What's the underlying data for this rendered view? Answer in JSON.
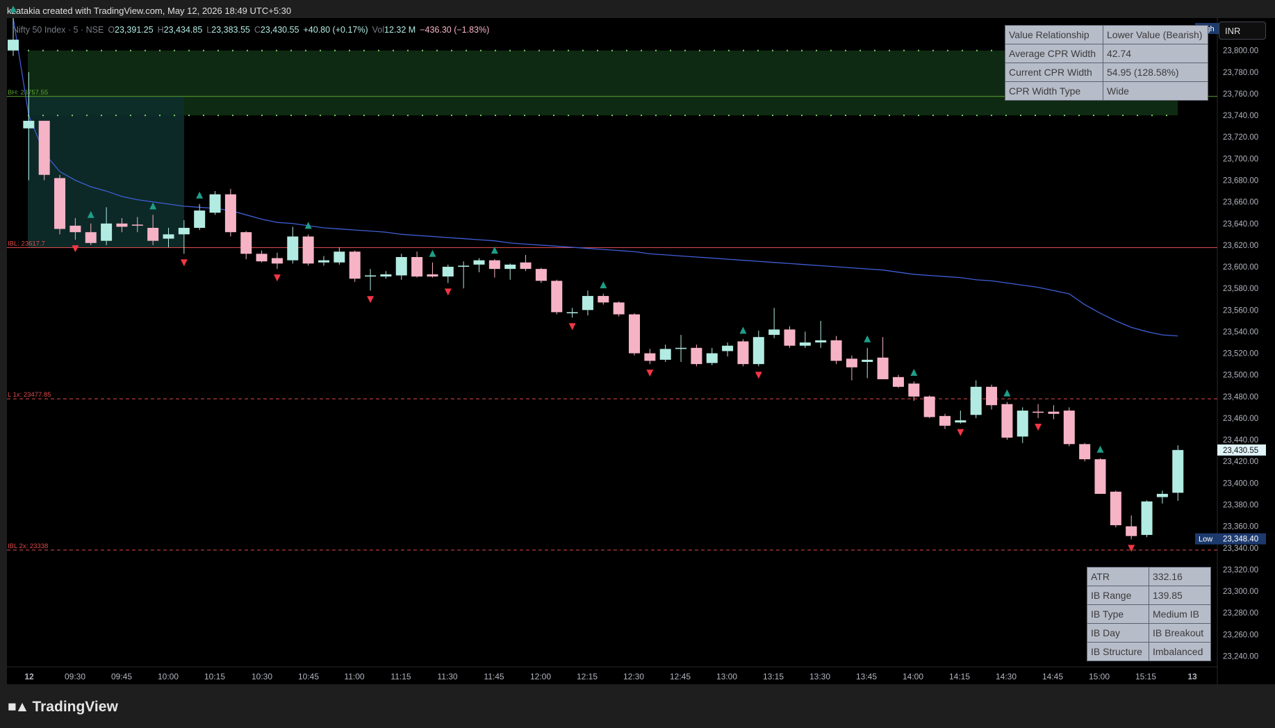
{
  "header": {
    "credit": "kzatakia created with TradingView.com, May 12, 2026 18:49 UTC+5:30"
  },
  "legend": {
    "symbol": "Nifty 50 Index · 5 · NSE",
    "open_label": "O",
    "open": "23,391.25",
    "high_label": "H",
    "high": "23,434.85",
    "low_label": "L",
    "low": "23,383.55",
    "close_label": "C",
    "close": "23,430.55",
    "change": "+40.80 (+0.17%)",
    "vol_label": "Vol",
    "vol": "12.32 M",
    "day_change": "−436.30 (−1.83%)"
  },
  "currency_button": "INR",
  "cpr_table": [
    [
      "Value Relationship",
      "Lower Value (Bearish)"
    ],
    [
      "Average CPR Width",
      "42.74"
    ],
    [
      "Current CPR Width",
      "54.95 (128.58%)"
    ],
    [
      "CPR Width Type",
      "Wide"
    ]
  ],
  "ib_table": [
    [
      "ATR",
      "332.16"
    ],
    [
      "IB Range",
      "139.85"
    ],
    [
      "IB Type",
      "Medium IB"
    ],
    [
      "IB Day",
      "IB Breakout"
    ],
    [
      "IB Structure",
      "Imbalanced"
    ]
  ],
  "footer": {
    "brand": "TradingView"
  },
  "colors": {
    "up": "#b2ebe2",
    "down": "#f7b3c6",
    "ema": "#3f5fd6",
    "ib_line": "#e04a4a",
    "bh_line": "#5aa832",
    "cpr_band": "#0f2a12",
    "ib_box": "#0d2e2b",
    "buy_signal": "#1f9e89",
    "sell_signal": "#f23645",
    "background": "#000000"
  },
  "chart_data": {
    "type": "candlestick",
    "ylim": [
      23230,
      23830
    ],
    "y_ticks": [
      23240,
      23260,
      23280,
      23300,
      23320,
      23340,
      23360,
      23380,
      23400,
      23420,
      23440,
      23460,
      23480,
      23500,
      23520,
      23540,
      23560,
      23580,
      23600,
      23620,
      23640,
      23660,
      23680,
      23700,
      23720,
      23740,
      23760,
      23780,
      23800
    ],
    "x_ticks": [
      "12",
      "09:30",
      "09:45",
      "10:00",
      "10:15",
      "10:30",
      "10:45",
      "11:00",
      "11:15",
      "11:30",
      "11:45",
      "12:00",
      "12:15",
      "12:30",
      "12:45",
      "13:00",
      "13:15",
      "13:30",
      "13:45",
      "14:00",
      "14:15",
      "14:30",
      "14:45",
      "15:00",
      "15:15",
      "13"
    ],
    "price_labels": [
      {
        "name": "High",
        "value": 23820.35,
        "text": "23,820.35"
      },
      {
        "name": "",
        "value": 23430.55,
        "text": "23,430.55"
      },
      {
        "name": "Low",
        "value": 23348.4,
        "text": "23,348.40"
      }
    ],
    "levels": [
      {
        "label": "BH: 23757.55",
        "value": 23757.55,
        "style": "solid"
      },
      {
        "label": "IBL: 23617.7",
        "value": 23617.7,
        "style": "solid"
      },
      {
        "label": "L 1x: 23477.85",
        "value": 23477.85,
        "style": "dashed"
      },
      {
        "label": "IBL 2x: 23338",
        "value": 23338,
        "style": "dashed"
      }
    ],
    "cpr_band": [
      23740,
      23800
    ],
    "ib_box": [
      23617.7,
      23757.55
    ],
    "candles": [
      {
        "o": 23800,
        "h": 23830,
        "l": 23795,
        "c": 23810
      },
      {
        "o": 23728,
        "h": 23780,
        "l": 23680,
        "c": 23735
      },
      {
        "o": 23735,
        "h": 23735,
        "l": 23680,
        "c": 23685
      },
      {
        "o": 23682,
        "h": 23685,
        "l": 23630,
        "c": 23635
      },
      {
        "o": 23638,
        "h": 23645,
        "l": 23625,
        "c": 23632
      },
      {
        "o": 23632,
        "h": 23640,
        "l": 23620,
        "c": 23622
      },
      {
        "o": 23624,
        "h": 23655,
        "l": 23620,
        "c": 23640
      },
      {
        "o": 23640,
        "h": 23645,
        "l": 23632,
        "c": 23637
      },
      {
        "o": 23639,
        "h": 23646,
        "l": 23632,
        "c": 23638
      },
      {
        "o": 23636,
        "h": 23648,
        "l": 23620,
        "c": 23624
      },
      {
        "o": 23626,
        "h": 23636,
        "l": 23618,
        "c": 23630
      },
      {
        "o": 23630,
        "h": 23643,
        "l": 23612,
        "c": 23636
      },
      {
        "o": 23636,
        "h": 23658,
        "l": 23634,
        "c": 23652
      },
      {
        "o": 23650,
        "h": 23670,
        "l": 23648,
        "c": 23667
      },
      {
        "o": 23667,
        "h": 23672,
        "l": 23628,
        "c": 23632
      },
      {
        "o": 23632,
        "h": 23633,
        "l": 23607,
        "c": 23612
      },
      {
        "o": 23612,
        "h": 23615,
        "l": 23604,
        "c": 23605
      },
      {
        "o": 23608,
        "h": 23613,
        "l": 23598,
        "c": 23603
      },
      {
        "o": 23606,
        "h": 23637,
        "l": 23603,
        "c": 23628
      },
      {
        "o": 23628,
        "h": 23630,
        "l": 23601,
        "c": 23603
      },
      {
        "o": 23604,
        "h": 23610,
        "l": 23601,
        "c": 23606
      },
      {
        "o": 23604,
        "h": 23618,
        "l": 23602,
        "c": 23614
      },
      {
        "o": 23614,
        "h": 23615,
        "l": 23586,
        "c": 23589
      },
      {
        "o": 23591,
        "h": 23598,
        "l": 23578,
        "c": 23592
      },
      {
        "o": 23591,
        "h": 23596,
        "l": 23589,
        "c": 23593
      },
      {
        "o": 23592,
        "h": 23612,
        "l": 23588,
        "c": 23609
      },
      {
        "o": 23609,
        "h": 23614,
        "l": 23590,
        "c": 23591
      },
      {
        "o": 23593,
        "h": 23604,
        "l": 23590,
        "c": 23591
      },
      {
        "o": 23591,
        "h": 23602,
        "l": 23585,
        "c": 23600
      },
      {
        "o": 23600,
        "h": 23605,
        "l": 23580,
        "c": 23601
      },
      {
        "o": 23602,
        "h": 23608,
        "l": 23595,
        "c": 23606
      },
      {
        "o": 23606,
        "h": 23607,
        "l": 23590,
        "c": 23598
      },
      {
        "o": 23598,
        "h": 23603,
        "l": 23588,
        "c": 23602
      },
      {
        "o": 23604,
        "h": 23611,
        "l": 23596,
        "c": 23598
      },
      {
        "o": 23598,
        "h": 23599,
        "l": 23585,
        "c": 23587
      },
      {
        "o": 23587,
        "h": 23588,
        "l": 23556,
        "c": 23558
      },
      {
        "o": 23557,
        "h": 23562,
        "l": 23553,
        "c": 23558
      },
      {
        "o": 23560,
        "h": 23578,
        "l": 23555,
        "c": 23573
      },
      {
        "o": 23573,
        "h": 23575,
        "l": 23565,
        "c": 23567
      },
      {
        "o": 23567,
        "h": 23568,
        "l": 23554,
        "c": 23556
      },
      {
        "o": 23556,
        "h": 23557,
        "l": 23518,
        "c": 23520
      },
      {
        "o": 23520,
        "h": 23524,
        "l": 23510,
        "c": 23513
      },
      {
        "o": 23514,
        "h": 23528,
        "l": 23512,
        "c": 23524
      },
      {
        "o": 23524,
        "h": 23537,
        "l": 23512,
        "c": 23525
      },
      {
        "o": 23525,
        "h": 23528,
        "l": 23508,
        "c": 23510
      },
      {
        "o": 23511,
        "h": 23525,
        "l": 23509,
        "c": 23520
      },
      {
        "o": 23522,
        "h": 23530,
        "l": 23517,
        "c": 23527
      },
      {
        "o": 23531,
        "h": 23533,
        "l": 23508,
        "c": 23510
      },
      {
        "o": 23510,
        "h": 23541,
        "l": 23508,
        "c": 23535
      },
      {
        "o": 23537,
        "h": 23562,
        "l": 23534,
        "c": 23542
      },
      {
        "o": 23542,
        "h": 23545,
        "l": 23525,
        "c": 23527
      },
      {
        "o": 23527,
        "h": 23540,
        "l": 23525,
        "c": 23530
      },
      {
        "o": 23530,
        "h": 23550,
        "l": 23525,
        "c": 23532
      },
      {
        "o": 23532,
        "h": 23536,
        "l": 23510,
        "c": 23513
      },
      {
        "o": 23515,
        "h": 23518,
        "l": 23495,
        "c": 23507
      },
      {
        "o": 23512,
        "h": 23525,
        "l": 23497,
        "c": 23514
      },
      {
        "o": 23516,
        "h": 23535,
        "l": 23496,
        "c": 23496
      },
      {
        "o": 23498,
        "h": 23500,
        "l": 23488,
        "c": 23489
      },
      {
        "o": 23492,
        "h": 23494,
        "l": 23476,
        "c": 23480
      },
      {
        "o": 23480,
        "h": 23481,
        "l": 23460,
        "c": 23461
      },
      {
        "o": 23462,
        "h": 23464,
        "l": 23450,
        "c": 23453
      },
      {
        "o": 23456,
        "h": 23467,
        "l": 23455,
        "c": 23458
      },
      {
        "o": 23463,
        "h": 23495,
        "l": 23460,
        "c": 23489
      },
      {
        "o": 23489,
        "h": 23491,
        "l": 23468,
        "c": 23472
      },
      {
        "o": 23473,
        "h": 23475,
        "l": 23440,
        "c": 23442
      },
      {
        "o": 23443,
        "h": 23470,
        "l": 23437,
        "c": 23467
      },
      {
        "o": 23466,
        "h": 23473,
        "l": 23460,
        "c": 23465
      },
      {
        "o": 23466,
        "h": 23472,
        "l": 23459,
        "c": 23464
      },
      {
        "o": 23467,
        "h": 23470,
        "l": 23434,
        "c": 23436
      },
      {
        "o": 23436,
        "h": 23437,
        "l": 23420,
        "c": 23422
      },
      {
        "o": 23422,
        "h": 23423,
        "l": 23390,
        "c": 23390
      },
      {
        "o": 23392,
        "h": 23393,
        "l": 23359,
        "c": 23361
      },
      {
        "o": 23360,
        "h": 23370,
        "l": 23348,
        "c": 23351
      },
      {
        "o": 23352,
        "h": 23384,
        "l": 23350,
        "c": 23383
      },
      {
        "o": 23387,
        "h": 23393,
        "l": 23381,
        "c": 23390
      },
      {
        "o": 23391,
        "h": 23434.85,
        "l": 23383.55,
        "c": 23430.55
      }
    ],
    "ema": [
      23830,
      23740,
      23705,
      23688,
      23680,
      23674,
      23670,
      23665,
      23662,
      23660,
      23658,
      23656,
      23655,
      23654,
      23652,
      23648,
      23644,
      23641,
      23640,
      23638,
      23636,
      23635,
      23634,
      23633,
      23632,
      23630,
      23629,
      23628,
      23627,
      23626,
      23625,
      23624,
      23622,
      23621,
      23620,
      23619,
      23618,
      23617,
      23616,
      23615,
      23614,
      23612,
      23611,
      23610,
      23609,
      23608,
      23607,
      23606,
      23605,
      23604,
      23603,
      23602,
      23601,
      23600,
      23599,
      23598,
      23597,
      23595,
      23593,
      23592,
      23591,
      23590,
      23588,
      23587,
      23585,
      23583,
      23581,
      23578,
      23575,
      23565,
      23557,
      23550,
      23544,
      23540,
      23537,
      23536
    ],
    "buy_signals": [
      0,
      5,
      9,
      12,
      19,
      27,
      31,
      38,
      47,
      55,
      58,
      64,
      70
    ],
    "sell_signals": [
      4,
      11,
      17,
      23,
      28,
      36,
      41,
      48,
      61,
      66,
      72
    ]
  }
}
